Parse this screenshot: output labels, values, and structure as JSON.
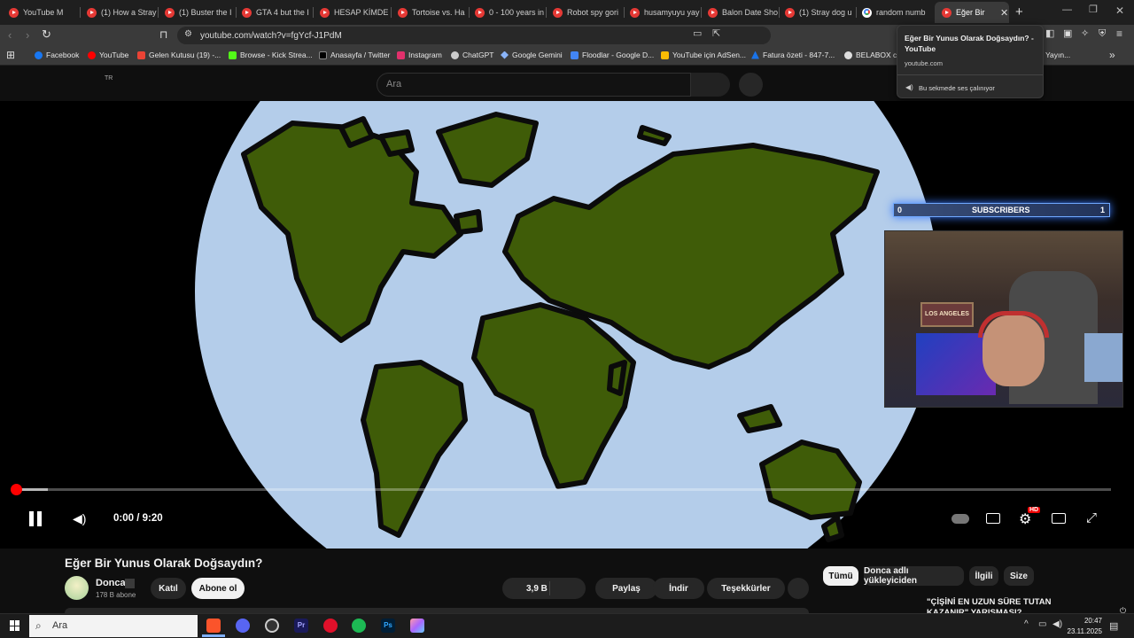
{
  "browser": {
    "tabs": [
      {
        "label": "YouTube M"
      },
      {
        "label": "(1) How a Stray"
      },
      {
        "label": "(1) Buster the I"
      },
      {
        "label": "GTA 4 but the I"
      },
      {
        "label": "HESAP KİMDE"
      },
      {
        "label": "Tortoise vs. Ha"
      },
      {
        "label": "0 - 100 years in"
      },
      {
        "label": "Robot spy gori"
      },
      {
        "label": "husamyuyu yay"
      },
      {
        "label": "Balon Date Sho"
      },
      {
        "label": "(1) Stray dog u"
      },
      {
        "label": "random numb"
      },
      {
        "label": "Eğer Bir"
      }
    ],
    "url": "youtube.com/watch?v=fgYcf-J1PdM",
    "bookmarks": [
      {
        "label": "Facebook",
        "color": "#1877f2"
      },
      {
        "label": "YouTube",
        "color": "#ff0000"
      },
      {
        "label": "Gelen Kutusu (19) -...",
        "color": "#ea4335"
      },
      {
        "label": "Browse - Kick Strea...",
        "color": "#53fc18"
      },
      {
        "label": "Anasayfa / Twitter",
        "color": "#000000"
      },
      {
        "label": "Instagram",
        "color": "#e1306c"
      },
      {
        "label": "ChatGPT",
        "color": "#cccccc"
      },
      {
        "label": "Google Gemini",
        "color": "#8ab4f8"
      },
      {
        "label": "Floodlar - Google D...",
        "color": "#4285f4"
      },
      {
        "label": "YouTube için AdSen...",
        "color": "#fbbc04"
      },
      {
        "label": "Fatura özeti - 847-7...",
        "color": "#1a73e8"
      },
      {
        "label": "BELABOX clo",
        "color": "#dddddd"
      },
      {
        "label": "Yayın...",
        "color": "#888888"
      }
    ],
    "popup": {
      "title": "Eğer Bir Yunus Olarak Doğsaydın? - YouTube",
      "domain": "youtube.com",
      "audio": "Bu sekmede ses çalınıyor"
    }
  },
  "youtube": {
    "country": "TR",
    "search_placeholder": "Ara",
    "player": {
      "time": "0:00 / 9:20",
      "hd_badge": "HD",
      "progress": 0.003
    },
    "overlay": {
      "subs_label": "SUBSCRIBERS",
      "subs_left": "0",
      "subs_right": "1",
      "poster_text": "LOS ANGELES"
    },
    "video_title": "Eğer Bir Yunus Olarak Doğsaydın?",
    "channel": "Donca",
    "subscribers": "178 B abone",
    "join": "Katıl",
    "subscribe": "Abone ol",
    "likes": "3,9 B",
    "share": "Paylaş",
    "download": "İndir",
    "thanks": "Teşekkürler",
    "chips": [
      "Tümü",
      "Donca adlı yükleyiciden",
      "İlgili",
      "Size"
    ],
    "side_snippet": "\"ÇİŞİNİ EN UZUN SÜRE TUTAN KAZANIR\" YARIŞMASI?"
  },
  "taskbar": {
    "search": "Ara",
    "time": "20:47",
    "date": "23.11.2025"
  }
}
